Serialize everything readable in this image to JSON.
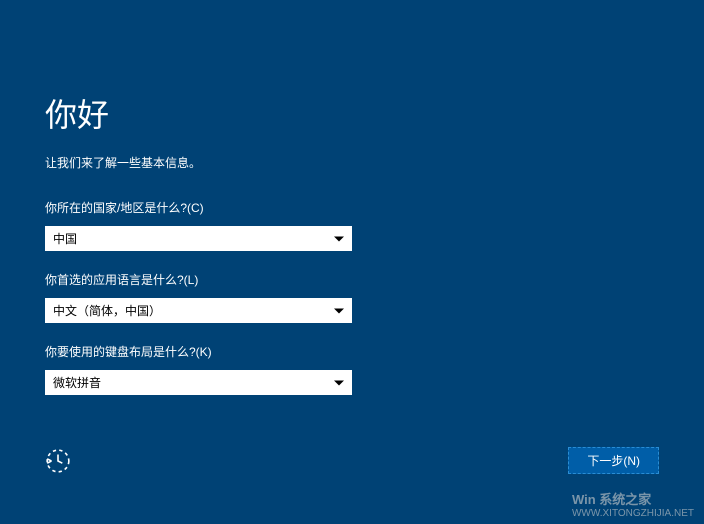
{
  "header": {
    "title": "你好",
    "subtitle": "让我们来了解一些基本信息。"
  },
  "fields": {
    "country": {
      "label": "你所在的国家/地区是什么?(C)",
      "value": "中国"
    },
    "language": {
      "label": "你首选的应用语言是什么?(L)",
      "value": "中文（简体，中国）"
    },
    "keyboard": {
      "label": "你要使用的键盘布局是什么?(K)",
      "value": "微软拼音"
    }
  },
  "buttons": {
    "next": "下一步(N)"
  },
  "watermark": {
    "line1": "Win 系统之家",
    "line2": "WWW.XITONGZHIJIA.NET"
  }
}
